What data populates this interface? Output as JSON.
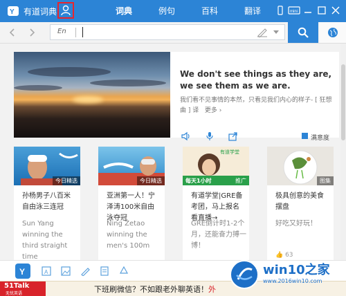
{
  "app": {
    "title": "有道词典",
    "brand_color": "#2c84d6"
  },
  "tabs": [
    {
      "label": "词典",
      "active": true
    },
    {
      "label": "例句",
      "active": false
    },
    {
      "label": "百科",
      "active": false
    },
    {
      "label": "翻译",
      "active": false
    }
  ],
  "search": {
    "lang_label": "En",
    "value": ""
  },
  "hero": {
    "quote_en": "We don't see things as they are, we see them as we are.",
    "quote_cn": "我们看不见事情的本然，只看见我们内心的样子- [ 狂想曲 ] 译",
    "more": "更多",
    "satisfaction": "满意度"
  },
  "cards": [
    {
      "title": "孙杨男子八百米自由泳三连冠",
      "subtitle": "Sun Yang winning the third straight time",
      "badge": "今日精选"
    },
    {
      "title": "亚洲第一人！宁泽涛100米自由泳夺冠",
      "subtitle": "Ning Zetao winning the men's 100m",
      "badge": "今日精选"
    },
    {
      "title": "有道学堂|GRE备考团，马上报名看直播→",
      "subtitle": "GRE倒计时1-2个月，还能奋力搏一博！",
      "badge": "推广",
      "image_text": "每天1小时",
      "brand_text": "有道学堂"
    },
    {
      "title": "极具创意的美食摆盘",
      "subtitle": "好吃又好玩！",
      "badge": "图集",
      "likes": "63"
    }
  ],
  "ad": {
    "logo_text": "51Talk",
    "logo_sub": "无忧英语",
    "text_main": "下班刷微信？不如跟老外聊英语！",
    "text_highlight": "外"
  },
  "watermark": {
    "title": "win10之家",
    "url": "www.2016win10.com"
  }
}
